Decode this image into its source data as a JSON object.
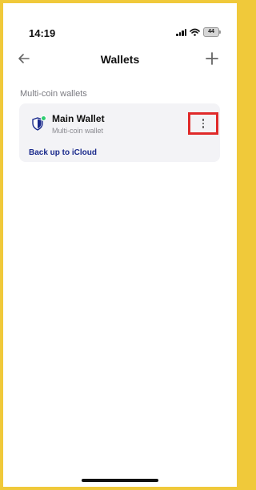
{
  "status_bar": {
    "time": "14:19",
    "battery": "44",
    "icons": [
      "signal-icon",
      "wifi-icon",
      "battery-icon"
    ]
  },
  "nav": {
    "back_icon": "arrow-left-icon",
    "title": "Wallets",
    "add_icon": "plus-icon"
  },
  "section": {
    "title": "Multi-coin wallets"
  },
  "wallet": {
    "name": "Main Wallet",
    "subtitle": "Multi-coin wallet",
    "icon": "shield-icon",
    "status_color": "#2ecc71",
    "more_icon": "more-vertical-icon",
    "backup_label": "Back up to iCloud"
  },
  "colors": {
    "frame": "#f0c93a",
    "accent_link": "#1a2a8c",
    "highlight": "#e02a2a",
    "card_bg": "#f3f3f6"
  }
}
